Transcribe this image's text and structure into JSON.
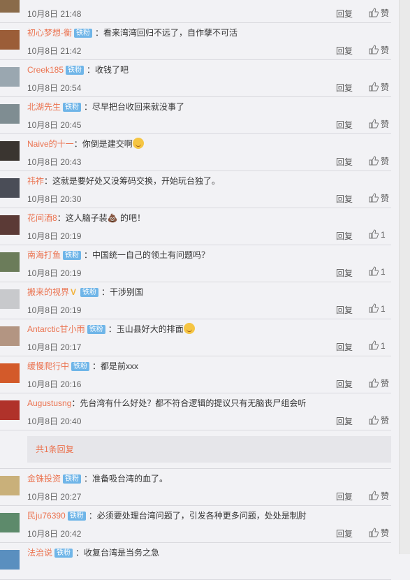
{
  "comments": [
    {
      "user": "",
      "badge": "",
      "text": "",
      "time": "10月8日 21:48",
      "reply": "回复",
      "like": "赞",
      "avatar": "#8a6b4a"
    },
    {
      "user": "初心梦想-衡",
      "badge": "铁粉",
      "text": "：看来湾湾回归不远了，自作孽不可活",
      "time": "10月8日 21:42",
      "reply": "回复",
      "like": "赞",
      "avatar": "#9b5d38"
    },
    {
      "user": "Creek185",
      "badge": "铁粉",
      "text": "：收钱了吧",
      "time": "10月8日 20:54",
      "reply": "回复",
      "like": "赞",
      "avatar": "#9aa7b0"
    },
    {
      "user": "北湖先生",
      "badge": "铁粉",
      "text": "：尽早把台收回来就没事了",
      "time": "10月8日 20:45",
      "reply": "回复",
      "like": "赞",
      "avatar": "#7f8d92"
    },
    {
      "user": "Naive的十一",
      "badge": "",
      "text": "：你倒是建交啊",
      "time": "10月8日 20:43",
      "reply": "回复",
      "like": "赞",
      "avatar": "#3a3530",
      "emoji": true
    },
    {
      "user": "祎祚",
      "badge": "",
      "text": "：这就是要好处又没筹码交换，开始玩台独了。",
      "time": "10月8日 20:30",
      "reply": "回复",
      "like": "赞",
      "avatar": "#4a4d57"
    },
    {
      "user": "花间酒8",
      "badge": "",
      "text": "：这人脑子装💩 的吧！",
      "time": "10月8日 20:19",
      "reply": "回复",
      "like": "1",
      "avatar": "#5b3a36"
    },
    {
      "user": "南海打鱼",
      "badge": "铁粉",
      "text": "：中国统一自己的领土有问题吗？",
      "time": "10月8日 20:19",
      "reply": "回复",
      "like": "1",
      "avatar": "#6b7c5a"
    },
    {
      "user": "搬来的视界",
      "badge": "铁粉",
      "vbadge": "V",
      "text": "：干涉别国",
      "time": "10月8日 20:19",
      "reply": "回复",
      "like": "1",
      "avatar": "#c8c9cc"
    },
    {
      "user": "Antarctic甘小雨",
      "badge": "铁粉",
      "text": "：玉山县好大的排面",
      "time": "10月8日 20:17",
      "reply": "回复",
      "like": "1",
      "avatar": "#b39582",
      "emoji": true
    },
    {
      "user": "缓慢爬行中",
      "badge": "铁粉",
      "text": "：都是前xxx",
      "time": "10月8日 20:16",
      "reply": "回复",
      "like": "赞",
      "avatar": "#d35a2a"
    },
    {
      "user": "Augustusng",
      "badge": "",
      "text": "：先台湾有什么好处？都不符合逻辑的提议只有无脑丧尸组会听",
      "time": "10月8日 20:40",
      "reply": "回复",
      "like": "赞",
      "avatar": "#b0322a",
      "sub": "共1条回复"
    },
    {
      "user": "金铢投资",
      "badge": "铁粉",
      "text": "：准备吸台湾的血了。",
      "time": "10月8日 20:27",
      "reply": "回复",
      "like": "赞",
      "avatar": "#c9b07a"
    },
    {
      "user": "民ju76390",
      "badge": "铁粉",
      "text": "：必须要处理台湾问题了，引发各种更多问题，处处是制肘",
      "time": "10月8日 20:42",
      "reply": "回复",
      "like": "赞",
      "avatar": "#5d8a6b"
    },
    {
      "user": "法治说",
      "badge": "铁粉",
      "text": "：收复台湾是当务之急",
      "time": "",
      "reply": "",
      "like": "",
      "avatar": "#5a8fbf"
    }
  ]
}
